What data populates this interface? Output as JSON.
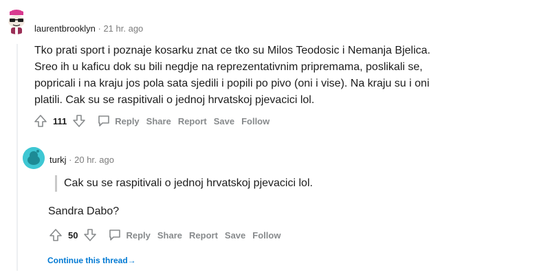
{
  "comment1": {
    "author": "laurentbrooklyn",
    "separator": " · ",
    "time": "21 hr. ago",
    "body": "Tko prati sport i poznaje kosarku znat ce tko su Milos Teodosic i Nemanja Bjelica. Sreo ih u kaficu dok su bili negdje na reprezentativnim pripremama, poslikali se, popricali i na kraju jos pola sata sjedili i popili po pivo (oni i vise). Na kraju su i oni platili. Cak su se raspitivali o jednoj hrvatskoj pjevacici lol.",
    "score": "111",
    "actions": {
      "reply": "Reply",
      "share": "Share",
      "report": "Report",
      "save": "Save",
      "follow": "Follow"
    }
  },
  "comment2": {
    "author": "turkj",
    "separator": " · ",
    "time": "20 hr. ago",
    "quote": "Cak su se raspitivali o jednoj hrvatskoj pjevacici lol.",
    "body": "Sandra Dabo?",
    "score": "50",
    "actions": {
      "reply": "Reply",
      "share": "Share",
      "report": "Report",
      "save": "Save",
      "follow": "Follow"
    }
  },
  "continue_thread": {
    "label": "Continue this thread",
    "arrow": "→"
  },
  "colors": {
    "link": "#0079d3",
    "muted": "#878a8c",
    "avatar2": "#3ec7d3"
  }
}
